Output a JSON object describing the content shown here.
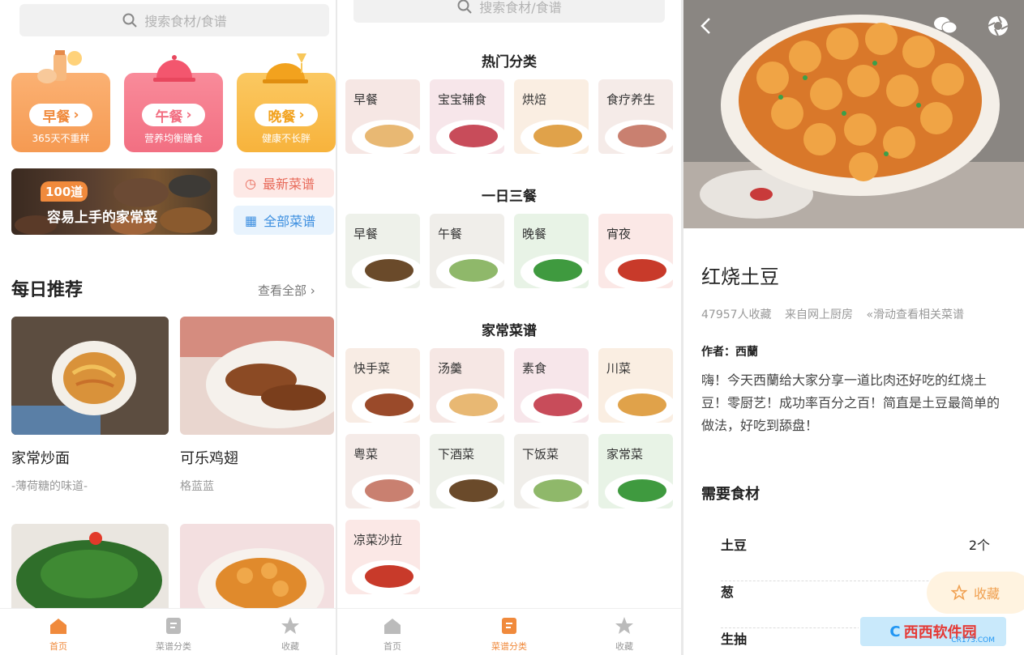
{
  "colors": {
    "accent": "#f08a3c",
    "breakfast": "#f59a52",
    "lunch": "#f26f82",
    "dinner": "#f7b33c",
    "chip_new_bg": "#fde9e6",
    "chip_new_fg": "#e86a5a",
    "chip_all_bg": "#e8f3fd",
    "chip_all_fg": "#3d8fe0"
  },
  "p1": {
    "search_placeholder": "搜索食材/食谱",
    "meals": [
      {
        "label": "早餐",
        "sub": "365天不重样"
      },
      {
        "label": "午餐",
        "sub": "营养均衡膳食"
      },
      {
        "label": "晚餐",
        "sub": "健康不长胖"
      }
    ],
    "promo": {
      "badge": "100道",
      "text": "容易上手的家常菜"
    },
    "chip_new": "最新菜谱",
    "chip_all": "全部菜谱",
    "daily_title": "每日推荐",
    "see_all": "查看全部",
    "recipes": [
      {
        "title": "家常炒面",
        "author": "-薄荷糖的味道-"
      },
      {
        "title": "可乐鸡翅",
        "author": "格蓝蓝"
      }
    ],
    "tabs": [
      {
        "label": "首页",
        "icon": "home-icon"
      },
      {
        "label": "菜谱分类",
        "icon": "recipe-book-icon"
      },
      {
        "label": "收藏",
        "icon": "star-icon"
      }
    ]
  },
  "p2": {
    "search_placeholder": "搜索食材/食谱",
    "sections": [
      {
        "title": "热门分类",
        "items": [
          "早餐",
          "宝宝辅食",
          "烘焙",
          "食疗养生"
        ]
      },
      {
        "title": "一日三餐",
        "items": [
          "早餐",
          "午餐",
          "晚餐",
          "宵夜"
        ]
      },
      {
        "title": "家常菜谱",
        "items": [
          "快手菜",
          "汤羹",
          "素食",
          "川菜",
          "粤菜",
          "下酒菜",
          "下饭菜",
          "家常菜",
          "凉菜沙拉"
        ]
      }
    ],
    "tabs": [
      {
        "label": "首页",
        "icon": "home-icon"
      },
      {
        "label": "菜谱分类",
        "icon": "recipe-book-icon"
      },
      {
        "label": "收藏",
        "icon": "star-icon"
      }
    ]
  },
  "p3": {
    "icons": [
      "back-icon",
      "wechat-icon",
      "moments-icon"
    ],
    "title": "红烧土豆",
    "favorites": "47957人收藏",
    "source": "来自网上厨房",
    "swipe_hint": "滑动查看相关菜谱",
    "author_label": "作者：",
    "author": "西蘭",
    "description": "嗨！今天西蘭给大家分享一道比肉还好吃的红烧土豆！零厨艺！成功率百分之百！简直是土豆最简单的做法，好吃到舔盘！",
    "ingredients_title": "需要食材",
    "ingredients": [
      {
        "name": "土豆",
        "qty": "2个"
      },
      {
        "name": "葱",
        "qty": ""
      },
      {
        "name": "生抽",
        "qty": ""
      }
    ],
    "fav_button": "收藏",
    "watermark": "西西软件园",
    "watermark_sub": "CR173.COM"
  }
}
